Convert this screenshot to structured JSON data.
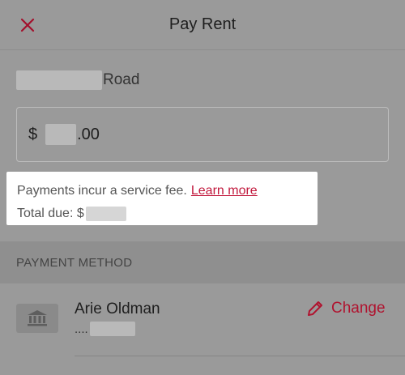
{
  "header": {
    "title": "Pay Rent",
    "close_icon": "close-icon"
  },
  "address": {
    "street_suffix": "Road"
  },
  "amount": {
    "currency_symbol": "$",
    "cents": ".00"
  },
  "fee_notice": {
    "text": "Payments incur a service fee.",
    "learn_more_label": "Learn more",
    "total_due_label": "Total due: $"
  },
  "payment_method": {
    "section_label": "PAYMENT METHOD",
    "account_name": "Arie Oldman",
    "account_mask_prefix": "....",
    "bank_icon": "bank-icon",
    "change_label": "Change",
    "change_icon": "pencil-icon"
  },
  "colors": {
    "accent": "#c1183c",
    "overlay": "#9a9a9a"
  }
}
